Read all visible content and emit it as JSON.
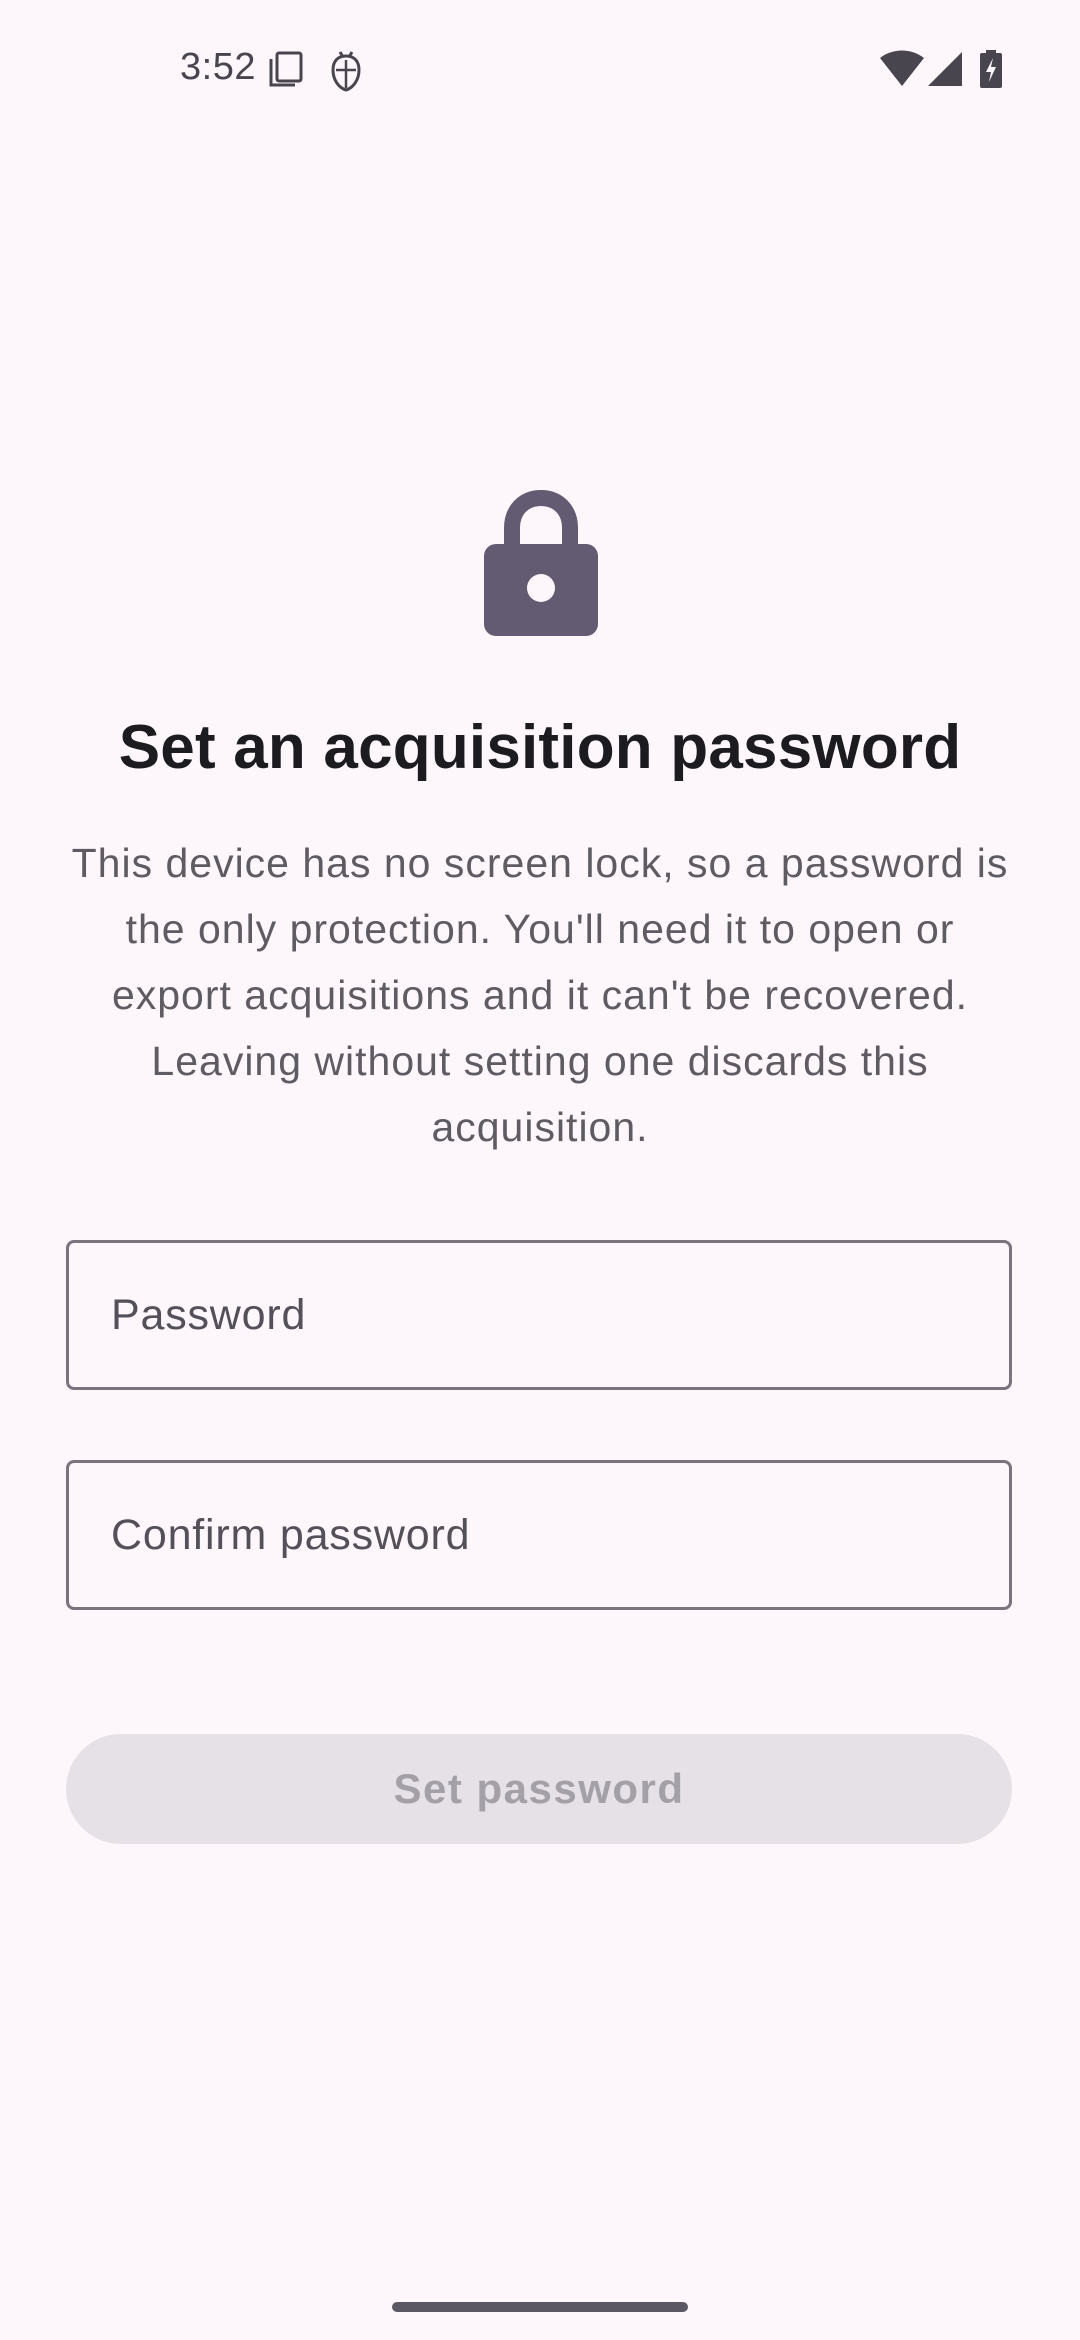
{
  "status_bar": {
    "time": "3:52",
    "icons": [
      "copy-icon",
      "bug-icon",
      "wifi-icon",
      "cell-signal-icon",
      "battery-charging-icon"
    ]
  },
  "lock_icon": "lock-icon",
  "title": "Set an acquisition password",
  "description": "This device has no screen lock, so a password is the only protection. You'll need it to open or export acquisitions and it can't be recovered. Leaving without setting one discards this acquisition.",
  "fields": {
    "password": {
      "placeholder": "Password",
      "value": ""
    },
    "confirm": {
      "placeholder": "Confirm password",
      "value": ""
    }
  },
  "button": {
    "label": "Set password",
    "enabled": false
  },
  "colors": {
    "background": "#fdf7fc",
    "lock": "#625b71",
    "button_disabled_bg": "#e5e1e6",
    "button_disabled_text": "#a4a0a8"
  }
}
